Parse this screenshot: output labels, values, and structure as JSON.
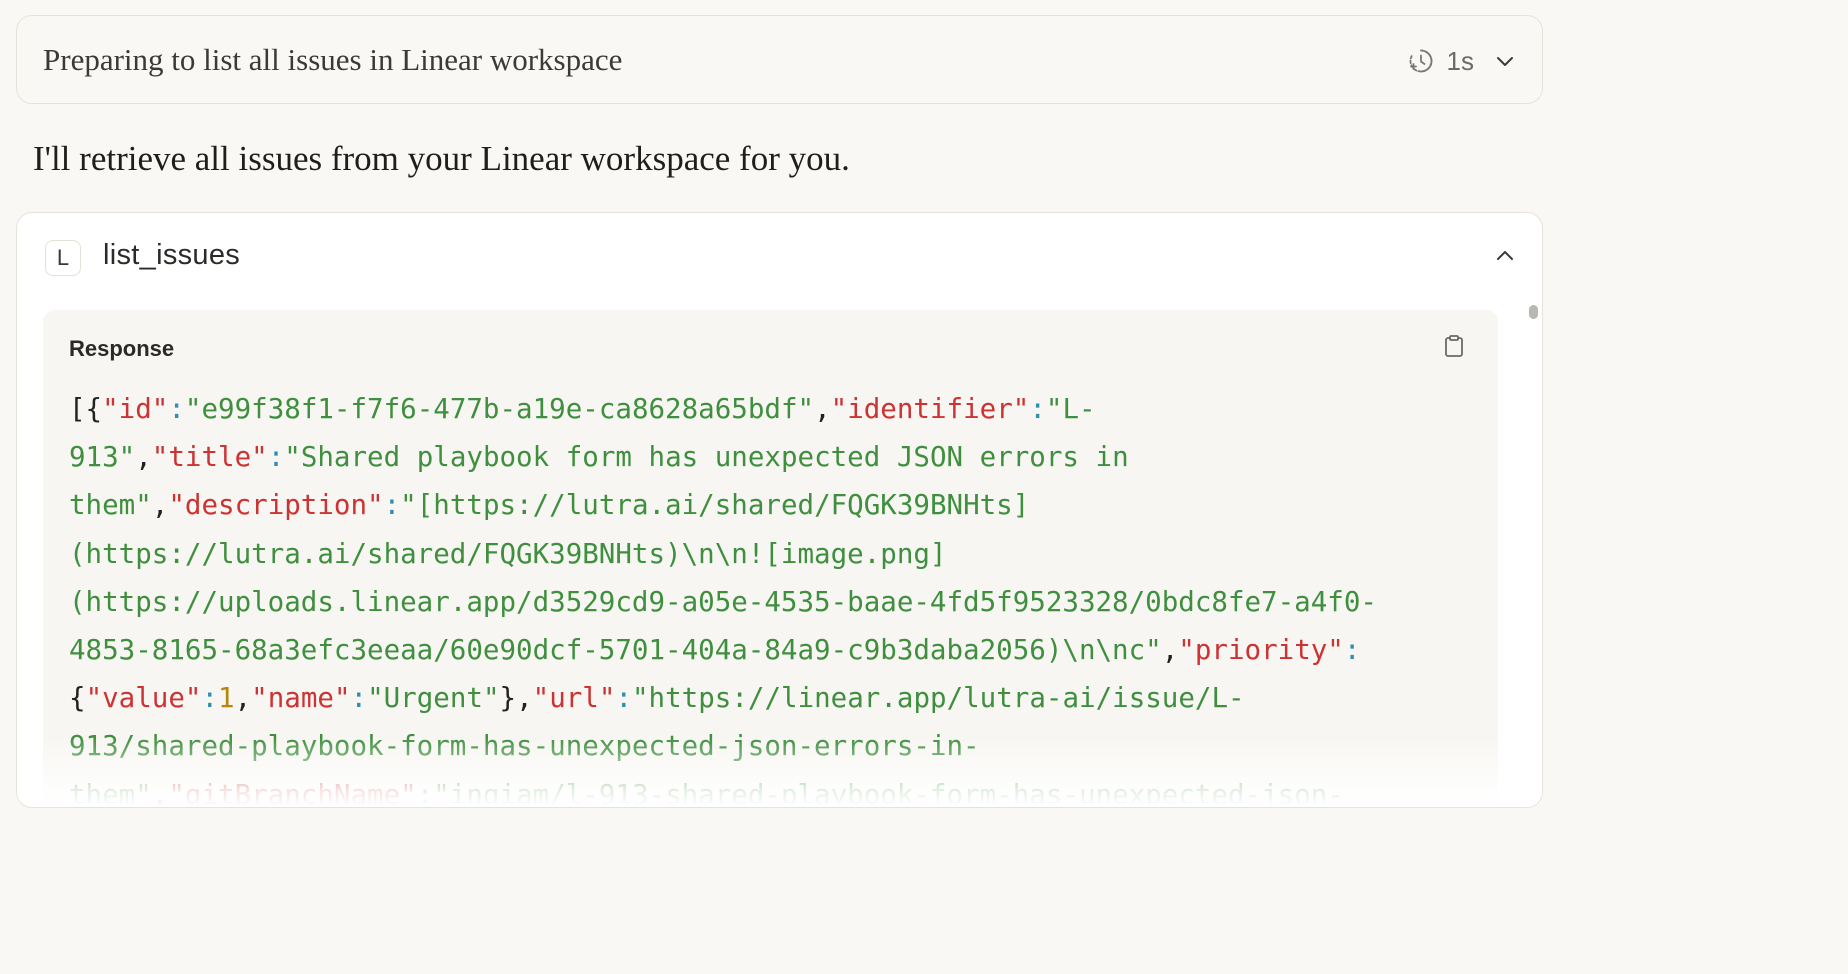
{
  "thinking": {
    "title": "Preparing to list all issues in Linear workspace",
    "duration": "1s",
    "icons": [
      "timer-icon",
      "chevron-down-icon"
    ]
  },
  "assistant_message": "I'll retrieve all issues from your Linear workspace for you.",
  "tool": {
    "badge": "L",
    "name": "list_issues",
    "collapse_icon": "chevron-up-icon",
    "response_label": "Response",
    "copy_icon": "clipboard-icon",
    "response_lines": [
      [
        {
          "t": "p",
          "v": "[{"
        },
        {
          "t": "k",
          "v": "\"id\""
        },
        {
          "t": "c",
          "v": ":"
        },
        {
          "t": "s",
          "v": "\"e99f38f1-f7f6-477b-a19e-ca8628a65bdf\""
        },
        {
          "t": "p",
          "v": ","
        },
        {
          "t": "k",
          "v": "\"identifier\""
        },
        {
          "t": "c",
          "v": ":"
        },
        {
          "t": "s",
          "v": "\"L-"
        }
      ],
      [
        {
          "t": "s",
          "v": "913\""
        },
        {
          "t": "p",
          "v": ","
        },
        {
          "t": "k",
          "v": "\"title\""
        },
        {
          "t": "c",
          "v": ":"
        },
        {
          "t": "s",
          "v": "\"Shared playbook form has unexpected JSON errors in"
        }
      ],
      [
        {
          "t": "s",
          "v": "them\""
        },
        {
          "t": "p",
          "v": ","
        },
        {
          "t": "k",
          "v": "\"description\""
        },
        {
          "t": "c",
          "v": ":"
        },
        {
          "t": "s",
          "v": "\"[https://lutra.ai/shared/FQGK39BNHts]"
        }
      ],
      [
        {
          "t": "s",
          "v": "(https://lutra.ai/shared/FQGK39BNHts)\\n\\n![image.png]"
        }
      ],
      [
        {
          "t": "s",
          "v": "(https://uploads.linear.app/d3529cd9-a05e-4535-baae-4fd5f9523328/0bdc8fe7-a4f0-"
        }
      ],
      [
        {
          "t": "s",
          "v": "4853-8165-68a3efc3eeaa/60e90dcf-5701-404a-84a9-c9b3daba2056)\\n\\nc\""
        },
        {
          "t": "p",
          "v": ","
        },
        {
          "t": "k",
          "v": "\"priority\""
        },
        {
          "t": "c",
          "v": ":"
        }
      ],
      [
        {
          "t": "p",
          "v": "{"
        },
        {
          "t": "k",
          "v": "\"value\""
        },
        {
          "t": "c",
          "v": ":"
        },
        {
          "t": "n",
          "v": "1"
        },
        {
          "t": "p",
          "v": ","
        },
        {
          "t": "k",
          "v": "\"name\""
        },
        {
          "t": "c",
          "v": ":"
        },
        {
          "t": "s",
          "v": "\"Urgent\""
        },
        {
          "t": "p",
          "v": "},"
        },
        {
          "t": "k",
          "v": "\"url\""
        },
        {
          "t": "c",
          "v": ":"
        },
        {
          "t": "s",
          "v": "\"https://linear.app/lutra-ai/issue/L-"
        }
      ],
      [
        {
          "t": "s",
          "v": "913/shared-playbook-form-has-unexpected-json-errors-in-"
        }
      ],
      [
        {
          "t": "s",
          "v": "them\""
        },
        {
          "t": "p",
          "v": ","
        },
        {
          "t": "k",
          "v": "\"gitBranchName\""
        },
        {
          "t": "c",
          "v": ":"
        },
        {
          "t": "s",
          "v": "\"ingiam/l-913-shared-playbook-form-has-unexpected-json-"
        }
      ]
    ]
  }
}
